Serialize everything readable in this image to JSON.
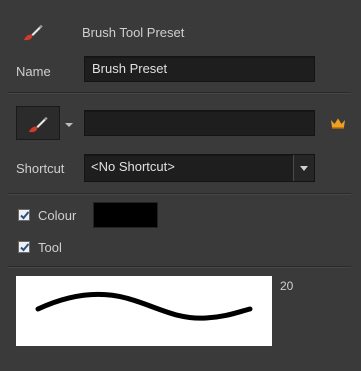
{
  "header": {
    "title": "Brush Tool Preset",
    "icon": "brush-icon"
  },
  "name_row": {
    "label": "Name",
    "value": "Brush Preset"
  },
  "tool_row": {
    "tool_icon": "brush-icon",
    "dropdown_icon": "caret-down-icon",
    "field_value": "",
    "crown_icon": "crown-icon"
  },
  "shortcut_row": {
    "label": "Shortcut",
    "value": "<No Shortcut>",
    "dropdown_icon": "caret-down-icon"
  },
  "options": {
    "colour": {
      "label": "Colour",
      "checked": true,
      "swatch": "#000000"
    },
    "tool": {
      "label": "Tool",
      "checked": true
    }
  },
  "preview": {
    "size_value": "20"
  },
  "colors": {
    "background": "#3a3a3a",
    "field": "#1e1e1e",
    "brush_red": "#d43a2a",
    "crown": "#f0a020"
  }
}
